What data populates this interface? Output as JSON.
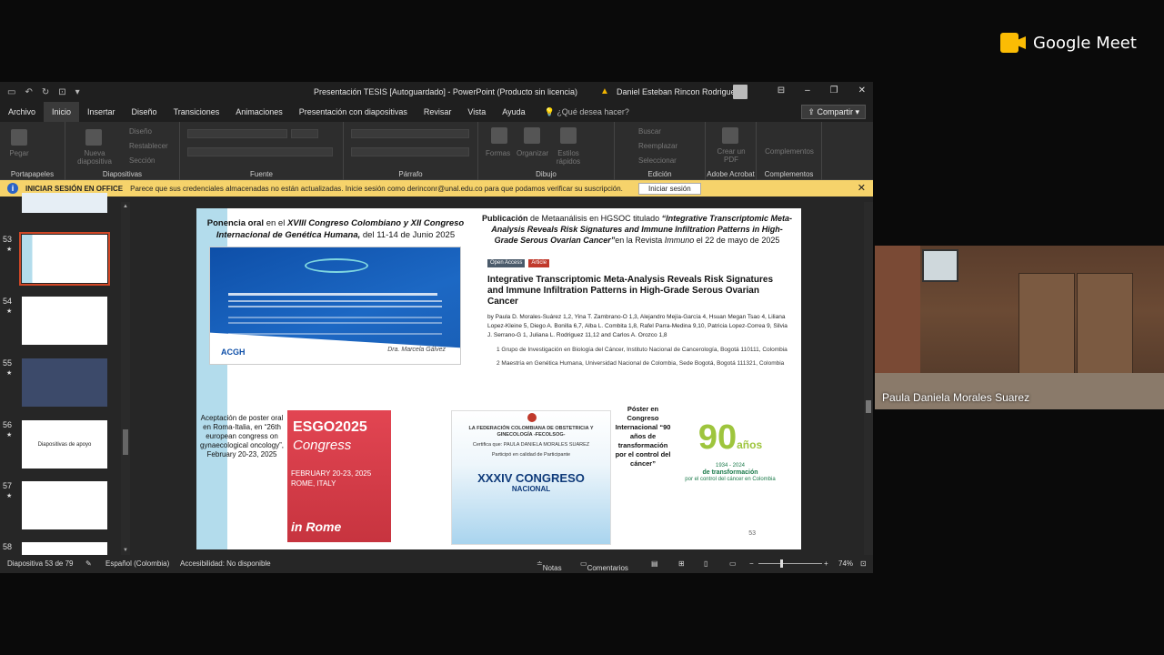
{
  "meet": {
    "logo_text": "Google Meet",
    "participant_name": "Paula Daniela Morales Suarez"
  },
  "ppt": {
    "title": "Presentación TESIS [Autoguardado] - PowerPoint (Producto sin licencia)",
    "user": "Daniel Esteban Rincon Rodriguez",
    "tabs": [
      "Archivo",
      "Inicio",
      "Insertar",
      "Diseño",
      "Transiciones",
      "Animaciones",
      "Presentación con diapositivas",
      "Revisar",
      "Vista",
      "Ayuda"
    ],
    "tell_me": "¿Qué desea hacer?",
    "share": "Compartir",
    "ribbon": {
      "pegar": "Pegar",
      "nueva_diapositiva": "Nueva diapositiva",
      "diseno": "Diseño",
      "restablecer": "Restablecer",
      "seccion": "Sección",
      "formas": "Formas",
      "organizar": "Organizar",
      "estilos": "Estilos rápidos",
      "buscar": "Buscar",
      "reemplazar": "Reemplazar",
      "seleccionar": "Seleccionar",
      "crear_pdf": "Crear un PDF",
      "complementos": "Complementos",
      "groups": [
        "Portapapeles",
        "Diapositivas",
        "Fuente",
        "Párrafo",
        "Dibujo",
        "Edición",
        "Adobe Acrobat",
        "Complementos"
      ]
    },
    "infobar": {
      "title": "INICIAR SESIÓN EN OFFICE",
      "message": "Parece que sus credenciales almacenadas no están actualizadas. Inicie sesión como derinconr@unal.edu.co para que podamos verificar su suscripción.",
      "button": "Iniciar sesión"
    },
    "slides": [
      {
        "num": "53"
      },
      {
        "num": "54"
      },
      {
        "num": "55"
      },
      {
        "num": "56",
        "text": "Diapositivas de apoyo"
      },
      {
        "num": "57"
      },
      {
        "num": "58"
      }
    ],
    "status": {
      "slide_counter": "Diapositiva 53 de 79",
      "language": "Español (Colombia)",
      "accessibility": "Accesibilidad: No disponible",
      "notes": "Notas",
      "comments": "Comentarios",
      "zoom": "74%"
    }
  },
  "slide": {
    "header1_bold": "Ponencia oral",
    "header1_rest": " en el ",
    "header1_italic": "XVIII Congreso Colombiano y XII Congreso Internacional de Genética Humana,",
    "header1_end": " del 11-14 de Junio 2025",
    "header2_bold": "Publicación",
    "header2_rest": " de Metaanálisis en HGSOC titulado ",
    "header2_italic": "“Integrative Transcriptomic Meta-Analysis Reveals Risk Signatures and Immune Infiltration Patterns in High-Grade Serous Ovarian Cancer”",
    "header2_end": "en la Revista ",
    "header2_journal": "Immuno",
    "header2_date": " el 22 de mayo de 2025",
    "cert_logo": "ACGH",
    "cert_signature": "Dra. Marcela Gálvez",
    "paper_badge1": "Open Access",
    "paper_badge2": "Article",
    "paper_title": "Integrative Transcriptomic Meta-Analysis Reveals Risk Signatures and Immune Infiltration Patterns in High-Grade Serous Ovarian Cancer",
    "paper_authors": "by Paula D. Morales-Suárez 1,2, Yina T. Zambrano-O 1,3, Alejandro Mejía-García 4, Hsuan Megan Tsao 4, Liliana Lopez-Kleine 5, Diego A. Bonilla 6,7, Alba L. Combita 1,8, Rafel Parra-Medina 9,10, Patricia Lopez-Correa 9, Silvia J. Serrano-G 1, Juliana L. Rodriguez 11,12 and Carlos A. Orozco 1,8",
    "paper_aff1": "1  Grupo de Investigación en Biología del Cáncer, Instituto Nacional de Cancerología, Bogotá 110111, Colombia",
    "paper_aff2": "2  Maestría en Genética Humana, Universidad Nacional de Colombia, Sede Bogotá, Bogotá 111321, Colombia",
    "poster1_text": "Aceptación de poster oral en Roma-Italia, en “26th european congress on gynaecological oncology”, February 20-23, 2025",
    "esgo_title": "ESGO2025",
    "esgo_congress": "Congress",
    "esgo_dates": "FEBRUARY 20-23, 2025",
    "esgo_place": "ROME, ITALY",
    "esgo_rome": "in Rome",
    "fcog_header": "LA FEDERACIÓN COLOMBIANA DE OBSTETRICIA Y GINECOLOGÍA -FECOLSOG-",
    "fcog_cert": "Certifica que: PAULA DANIELA MORALES SUAREZ",
    "fcog_role": "Participó en calidad de Participante",
    "fcog_big": "XXXIV CONGRESO",
    "fcog_big2": "NACIONAL",
    "poster2_text": "Póster en Congreso Internacional “90 años de transformación por el control del cáncer”",
    "anios_big": "90",
    "anios_sub": "años",
    "anios_years": "1934 - 2024",
    "anios_tag": "de transformación",
    "anios_tag2": "por el control del cáncer en Colombia",
    "page_number": "53"
  }
}
